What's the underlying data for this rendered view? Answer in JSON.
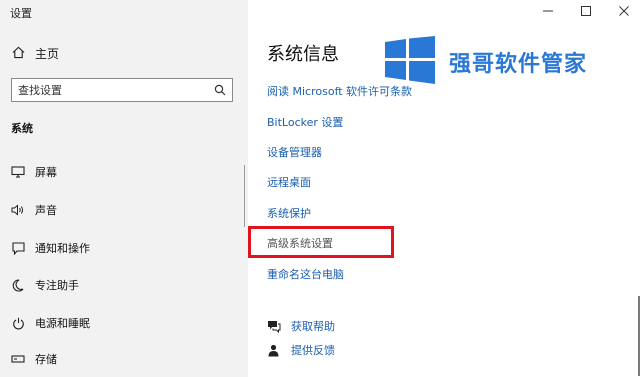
{
  "app": {
    "title": "设置"
  },
  "sidebar": {
    "home_label": "主页",
    "search_placeholder": "查找设置",
    "section_label": "系统",
    "items": [
      {
        "label": "屏幕",
        "icon": "monitor-icon"
      },
      {
        "label": "声音",
        "icon": "speaker-icon"
      },
      {
        "label": "通知和操作",
        "icon": "notification-icon"
      },
      {
        "label": "专注助手",
        "icon": "moon-icon"
      },
      {
        "label": "电源和睡眠",
        "icon": "power-icon"
      },
      {
        "label": "存储",
        "icon": "storage-icon"
      }
    ]
  },
  "window_controls": {
    "minimize": "—",
    "maximize": "☐",
    "close": "✕"
  },
  "main": {
    "page_title": "系统信息",
    "watermark": "强哥软件管家",
    "links": [
      "阅读 Microsoft 软件许可条款",
      "BitLocker 设置",
      "设备管理器",
      "远程桌面",
      "系统保护",
      "高级系统设置",
      "重命名这台电脑"
    ],
    "help": [
      {
        "label": "获取帮助",
        "icon": "help-chat-icon"
      },
      {
        "label": "提供反馈",
        "icon": "feedback-icon"
      }
    ]
  },
  "colors": {
    "link": "#1b5fae",
    "highlight": "#e0141e",
    "brand": "#2a78d6",
    "sidebar_bg": "#f2f2f2"
  }
}
